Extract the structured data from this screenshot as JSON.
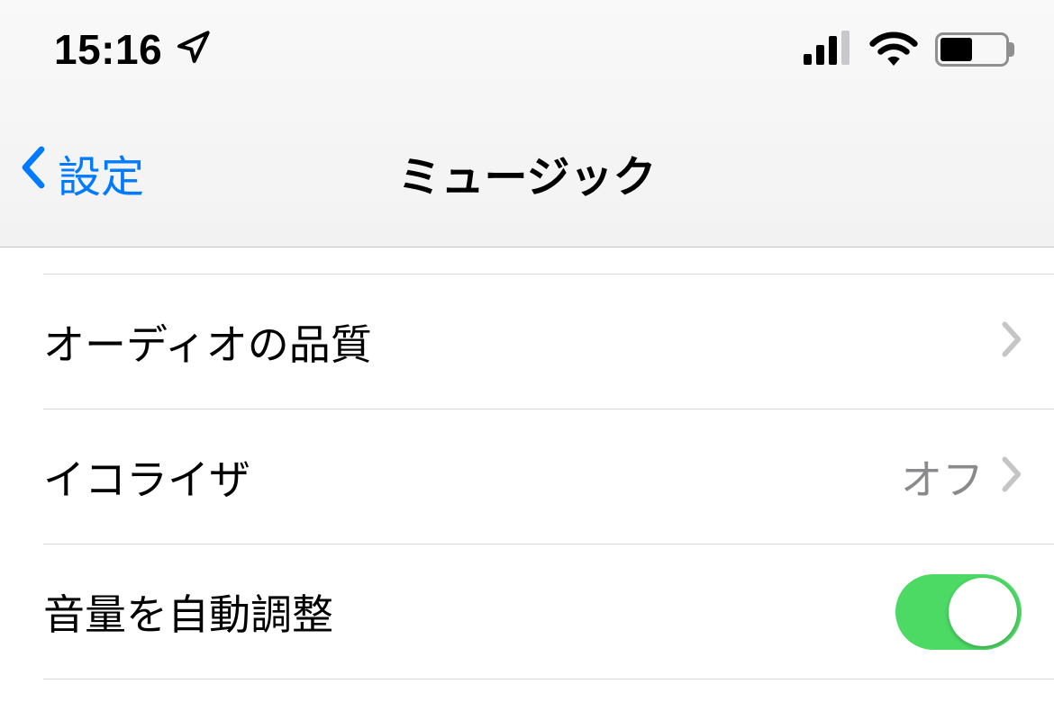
{
  "status": {
    "time": "15:16"
  },
  "nav": {
    "back_label": "設定",
    "title": "ミュージック"
  },
  "rows": {
    "audio_quality": {
      "label": "オーディオの品質"
    },
    "equalizer": {
      "label": "イコライザ",
      "value": "オフ"
    },
    "sound_check": {
      "label": "音量を自動調整",
      "on": true
    }
  }
}
